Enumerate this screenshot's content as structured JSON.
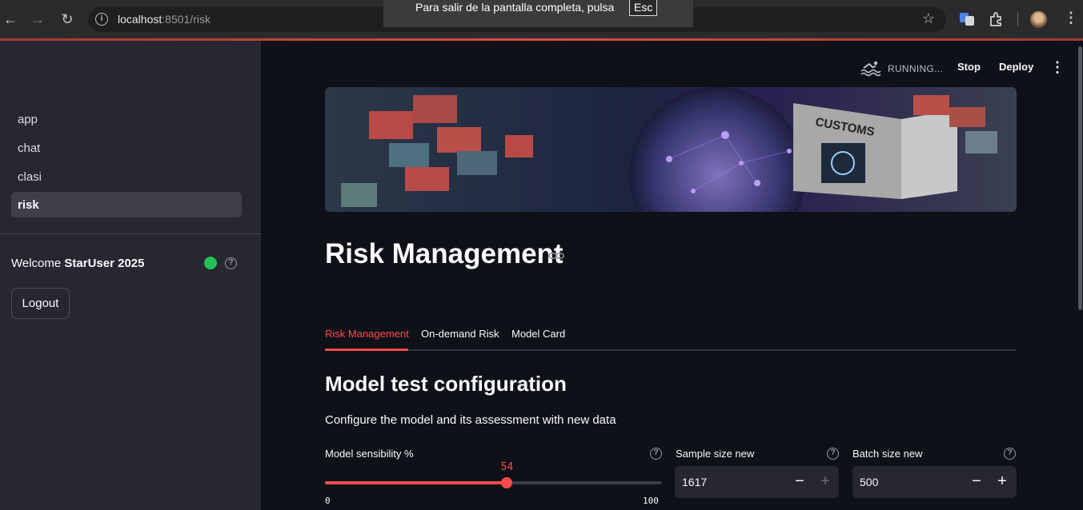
{
  "browser": {
    "url_host": "localhost",
    "url_rest": ":8501/risk",
    "fullscreen_notice": "Para salir de la pantalla completa, pulsa",
    "fullscreen_key": "Esc"
  },
  "sidebar": {
    "nav": [
      {
        "label": "app"
      },
      {
        "label": "chat"
      },
      {
        "label": "clasi"
      },
      {
        "label": "risk",
        "active": true
      }
    ],
    "welcome_prefix": "Welcome",
    "username": "StarUser 2025",
    "status_color": "#21c354",
    "logout_label": "Logout"
  },
  "header": {
    "running_label": "RUNNING...",
    "stop_label": "Stop",
    "deploy_label": "Deploy"
  },
  "banner": {
    "sign_text": "CUSTOMS"
  },
  "main": {
    "title": "Risk Management",
    "tabs": [
      {
        "label": "Risk Management",
        "active": true
      },
      {
        "label": "On-demand Risk"
      },
      {
        "label": "Model Card"
      }
    ],
    "section_title": "Model test configuration",
    "section_desc": "Configure the model and its assessment with new data",
    "sensibility": {
      "label": "Model sensibility %",
      "value": 54,
      "min": 0,
      "max": 100
    },
    "sample_size": {
      "label": "Sample size new",
      "value": "1617"
    },
    "batch_size": {
      "label": "Batch size new",
      "value": "500"
    }
  },
  "colors": {
    "accent": "#ff4b4b",
    "background": "#0e1117",
    "sidebar": "#262730"
  }
}
